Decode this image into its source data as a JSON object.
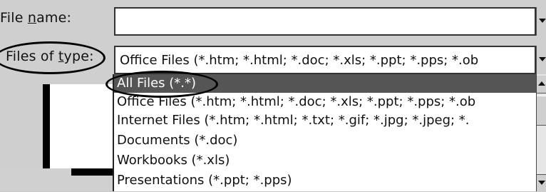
{
  "labels": {
    "file_name_prefix": "File ",
    "file_name_underlined": "n",
    "file_name_suffix": "ame:",
    "files_of_type_prefix": "Files of ",
    "files_of_type_underlined": "t",
    "files_of_type_suffix": "ype:"
  },
  "file_name": {
    "value": ""
  },
  "files_of_type": {
    "selected_value": "Office Files (*.htm; *.html; *.doc; *.xls; *.ppt; *.pps; *.ob"
  },
  "dropdown_list": {
    "items": [
      "All Files (*.*)",
      "Office Files (*.htm; *.html; *.doc; *.xls; *.ppt; *.pps; *.ob",
      "Internet Files (*.htm; *.html; *.txt; *.gif; *.jpg; *.jpeg; *.",
      "Documents (*.doc)",
      "Workbooks (*.xls)",
      "Presentations (*.ppt; *.pps)"
    ],
    "selected_index": 0
  },
  "icons": {
    "dropdown": "chevron-down-icon",
    "scroll_up": "scroll-up-arrow-icon",
    "scroll_down": "scroll-down-arrow-icon"
  },
  "colors": {
    "selection_bg": "#555555",
    "panel_bg": "#cfcfcf"
  }
}
